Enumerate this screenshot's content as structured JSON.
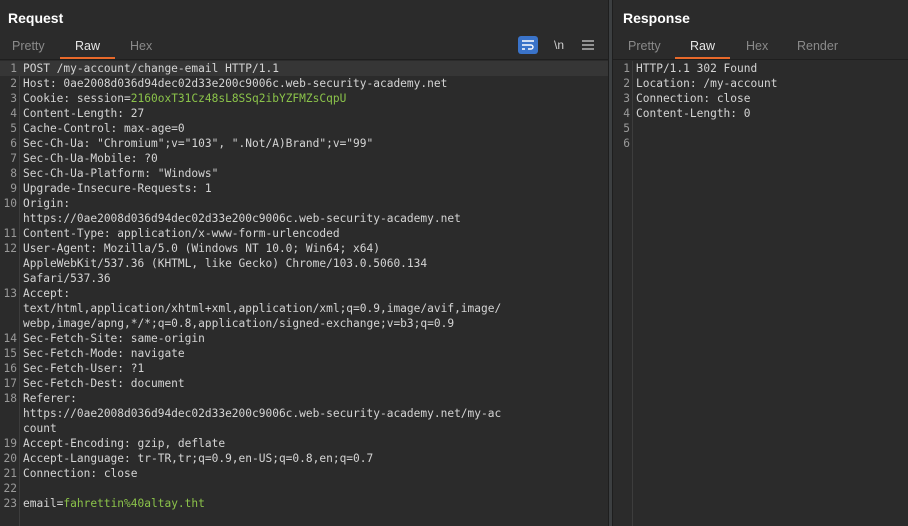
{
  "request": {
    "title": "Request",
    "tabs": [
      "Pretty",
      "Raw",
      "Hex"
    ],
    "active_tab": "Raw",
    "tools": {
      "wrap_icon": "wrap-lines-icon",
      "newline_label": "\\n",
      "menu_icon": "hamburger-menu-icon"
    },
    "lines": [
      {
        "n": "1",
        "t": "POST /my-account/change-email HTTP/1.1"
      },
      {
        "n": "2",
        "t": "Host: 0ae2008d036d94dec02d33e200c9006c.web-security-academy.net"
      },
      {
        "n": "3",
        "t": "Cookie: session=",
        "v": "2160oxT31Cz48sL8SSq2ibYZFMZsCqpU"
      },
      {
        "n": "4",
        "t": "Content-Length: 27"
      },
      {
        "n": "5",
        "t": "Cache-Control: max-age=0"
      },
      {
        "n": "6",
        "t": "Sec-Ch-Ua: \"Chromium\";v=\"103\", \".Not/A)Brand\";v=\"99\""
      },
      {
        "n": "7",
        "t": "Sec-Ch-Ua-Mobile: ?0"
      },
      {
        "n": "8",
        "t": "Sec-Ch-Ua-Platform: \"Windows\""
      },
      {
        "n": "9",
        "t": "Upgrade-Insecure-Requests: 1"
      },
      {
        "n": "10",
        "t": "Origin:"
      },
      {
        "n": "",
        "t": "https://0ae2008d036d94dec02d33e200c9006c.web-security-academy.net"
      },
      {
        "n": "11",
        "t": "Content-Type: application/x-www-form-urlencoded"
      },
      {
        "n": "12",
        "t": "User-Agent: Mozilla/5.0 (Windows NT 10.0; Win64; x64)"
      },
      {
        "n": "",
        "t": "AppleWebKit/537.36 (KHTML, like Gecko) Chrome/103.0.5060.134"
      },
      {
        "n": "",
        "t": "Safari/537.36"
      },
      {
        "n": "13",
        "t": "Accept:"
      },
      {
        "n": "",
        "t": "text/html,application/xhtml+xml,application/xml;q=0.9,image/avif,image/"
      },
      {
        "n": "",
        "t": "webp,image/apng,*/*;q=0.8,application/signed-exchange;v=b3;q=0.9"
      },
      {
        "n": "14",
        "t": "Sec-Fetch-Site: same-origin"
      },
      {
        "n": "15",
        "t": "Sec-Fetch-Mode: navigate"
      },
      {
        "n": "16",
        "t": "Sec-Fetch-User: ?1"
      },
      {
        "n": "17",
        "t": "Sec-Fetch-Dest: document"
      },
      {
        "n": "18",
        "t": "Referer:"
      },
      {
        "n": "",
        "t": "https://0ae2008d036d94dec02d33e200c9006c.web-security-academy.net/my-ac"
      },
      {
        "n": "",
        "t": "count"
      },
      {
        "n": "19",
        "t": "Accept-Encoding: gzip, deflate"
      },
      {
        "n": "20",
        "t": "Accept-Language: tr-TR,tr;q=0.9,en-US;q=0.8,en;q=0.7"
      },
      {
        "n": "21",
        "t": "Connection: close"
      },
      {
        "n": "22",
        "t": ""
      },
      {
        "n": "23",
        "t": "email=",
        "v": "fahrettin%40altay.tht"
      }
    ]
  },
  "response": {
    "title": "Response",
    "tabs": [
      "Pretty",
      "Raw",
      "Hex",
      "Render"
    ],
    "active_tab": "Raw",
    "lines": [
      {
        "n": "1",
        "t": "HTTP/1.1 302 Found"
      },
      {
        "n": "2",
        "t": "Location: /my-account"
      },
      {
        "n": "3",
        "t": "Connection: close"
      },
      {
        "n": "4",
        "t": "Content-Length: 0"
      },
      {
        "n": "5",
        "t": ""
      },
      {
        "n": "6",
        "t": ""
      }
    ]
  },
  "colors": {
    "accent": "#e8692a",
    "value_green": "#8bc34a",
    "wrap_button": "#3a73c9"
  }
}
